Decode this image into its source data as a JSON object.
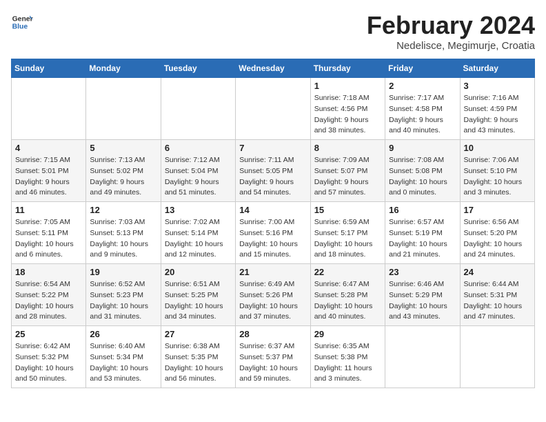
{
  "header": {
    "logo_general": "General",
    "logo_blue": "Blue",
    "month_title": "February 2024",
    "subtitle": "Nedelisce, Megimurje, Croatia"
  },
  "weekdays": [
    "Sunday",
    "Monday",
    "Tuesday",
    "Wednesday",
    "Thursday",
    "Friday",
    "Saturday"
  ],
  "weeks": [
    [
      {
        "day": "",
        "info": ""
      },
      {
        "day": "",
        "info": ""
      },
      {
        "day": "",
        "info": ""
      },
      {
        "day": "",
        "info": ""
      },
      {
        "day": "1",
        "info": "Sunrise: 7:18 AM\nSunset: 4:56 PM\nDaylight: 9 hours\nand 38 minutes."
      },
      {
        "day": "2",
        "info": "Sunrise: 7:17 AM\nSunset: 4:58 PM\nDaylight: 9 hours\nand 40 minutes."
      },
      {
        "day": "3",
        "info": "Sunrise: 7:16 AM\nSunset: 4:59 PM\nDaylight: 9 hours\nand 43 minutes."
      }
    ],
    [
      {
        "day": "4",
        "info": "Sunrise: 7:15 AM\nSunset: 5:01 PM\nDaylight: 9 hours\nand 46 minutes."
      },
      {
        "day": "5",
        "info": "Sunrise: 7:13 AM\nSunset: 5:02 PM\nDaylight: 9 hours\nand 49 minutes."
      },
      {
        "day": "6",
        "info": "Sunrise: 7:12 AM\nSunset: 5:04 PM\nDaylight: 9 hours\nand 51 minutes."
      },
      {
        "day": "7",
        "info": "Sunrise: 7:11 AM\nSunset: 5:05 PM\nDaylight: 9 hours\nand 54 minutes."
      },
      {
        "day": "8",
        "info": "Sunrise: 7:09 AM\nSunset: 5:07 PM\nDaylight: 9 hours\nand 57 minutes."
      },
      {
        "day": "9",
        "info": "Sunrise: 7:08 AM\nSunset: 5:08 PM\nDaylight: 10 hours\nand 0 minutes."
      },
      {
        "day": "10",
        "info": "Sunrise: 7:06 AM\nSunset: 5:10 PM\nDaylight: 10 hours\nand 3 minutes."
      }
    ],
    [
      {
        "day": "11",
        "info": "Sunrise: 7:05 AM\nSunset: 5:11 PM\nDaylight: 10 hours\nand 6 minutes."
      },
      {
        "day": "12",
        "info": "Sunrise: 7:03 AM\nSunset: 5:13 PM\nDaylight: 10 hours\nand 9 minutes."
      },
      {
        "day": "13",
        "info": "Sunrise: 7:02 AM\nSunset: 5:14 PM\nDaylight: 10 hours\nand 12 minutes."
      },
      {
        "day": "14",
        "info": "Sunrise: 7:00 AM\nSunset: 5:16 PM\nDaylight: 10 hours\nand 15 minutes."
      },
      {
        "day": "15",
        "info": "Sunrise: 6:59 AM\nSunset: 5:17 PM\nDaylight: 10 hours\nand 18 minutes."
      },
      {
        "day": "16",
        "info": "Sunrise: 6:57 AM\nSunset: 5:19 PM\nDaylight: 10 hours\nand 21 minutes."
      },
      {
        "day": "17",
        "info": "Sunrise: 6:56 AM\nSunset: 5:20 PM\nDaylight: 10 hours\nand 24 minutes."
      }
    ],
    [
      {
        "day": "18",
        "info": "Sunrise: 6:54 AM\nSunset: 5:22 PM\nDaylight: 10 hours\nand 28 minutes."
      },
      {
        "day": "19",
        "info": "Sunrise: 6:52 AM\nSunset: 5:23 PM\nDaylight: 10 hours\nand 31 minutes."
      },
      {
        "day": "20",
        "info": "Sunrise: 6:51 AM\nSunset: 5:25 PM\nDaylight: 10 hours\nand 34 minutes."
      },
      {
        "day": "21",
        "info": "Sunrise: 6:49 AM\nSunset: 5:26 PM\nDaylight: 10 hours\nand 37 minutes."
      },
      {
        "day": "22",
        "info": "Sunrise: 6:47 AM\nSunset: 5:28 PM\nDaylight: 10 hours\nand 40 minutes."
      },
      {
        "day": "23",
        "info": "Sunrise: 6:46 AM\nSunset: 5:29 PM\nDaylight: 10 hours\nand 43 minutes."
      },
      {
        "day": "24",
        "info": "Sunrise: 6:44 AM\nSunset: 5:31 PM\nDaylight: 10 hours\nand 47 minutes."
      }
    ],
    [
      {
        "day": "25",
        "info": "Sunrise: 6:42 AM\nSunset: 5:32 PM\nDaylight: 10 hours\nand 50 minutes."
      },
      {
        "day": "26",
        "info": "Sunrise: 6:40 AM\nSunset: 5:34 PM\nDaylight: 10 hours\nand 53 minutes."
      },
      {
        "day": "27",
        "info": "Sunrise: 6:38 AM\nSunset: 5:35 PM\nDaylight: 10 hours\nand 56 minutes."
      },
      {
        "day": "28",
        "info": "Sunrise: 6:37 AM\nSunset: 5:37 PM\nDaylight: 10 hours\nand 59 minutes."
      },
      {
        "day": "29",
        "info": "Sunrise: 6:35 AM\nSunset: 5:38 PM\nDaylight: 11 hours\nand 3 minutes."
      },
      {
        "day": "",
        "info": ""
      },
      {
        "day": "",
        "info": ""
      }
    ]
  ]
}
